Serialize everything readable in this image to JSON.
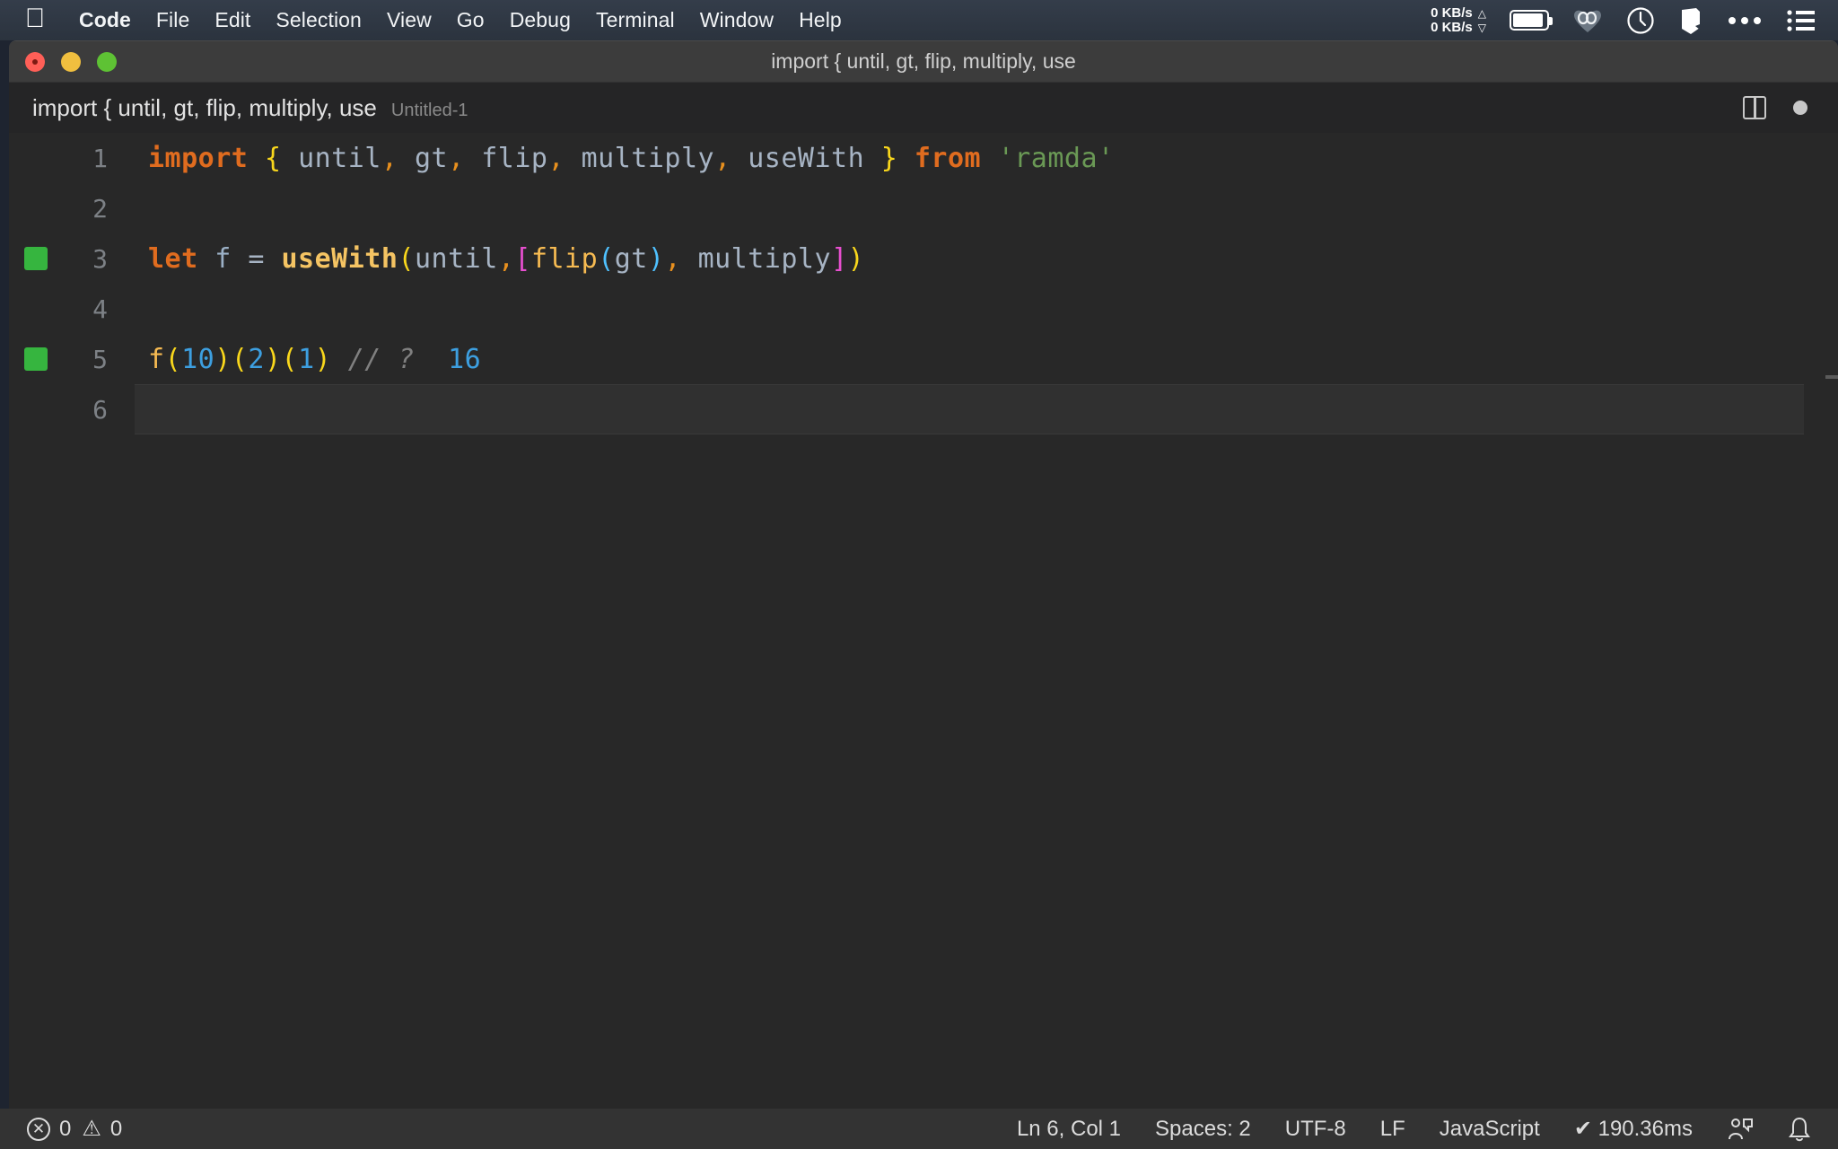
{
  "menubar": {
    "apple_icon": "apple-logo",
    "items": [
      "Code",
      "File",
      "Edit",
      "Selection",
      "View",
      "Go",
      "Debug",
      "Terminal",
      "Window",
      "Help"
    ],
    "status_icons": {
      "net_up": "0 KB/s",
      "net_down": "0 KB/s",
      "up_arrow": "△",
      "down_arrow": "▽",
      "battery": "battery-icon",
      "vpn": "vpn-icon",
      "clock": "clock-icon",
      "shield": "shield-icon",
      "more": "ellipsis-icon",
      "controlcenter": "list-icon"
    }
  },
  "window": {
    "title": "import { until, gt, flip, multiply, use",
    "traffic_lights": [
      "close",
      "minimize",
      "zoom"
    ]
  },
  "tab": {
    "label": "import { until, gt, flip, multiply, use",
    "sublabel": "Untitled-1",
    "split_editor_icon": "split-editor-icon",
    "dirty_indicator": "unsaved-dot-icon"
  },
  "editor": {
    "language": "JavaScript",
    "lines": [
      {
        "number": "1",
        "breakpoint": false,
        "active": false,
        "tokens": [
          {
            "t": "import",
            "c": "kw"
          },
          {
            "t": " ",
            "c": "ident"
          },
          {
            "t": "{",
            "c": "brace"
          },
          {
            "t": " ",
            "c": "ident"
          },
          {
            "t": "until",
            "c": "ident"
          },
          {
            "t": ",",
            "c": "comma"
          },
          {
            "t": " ",
            "c": "ident"
          },
          {
            "t": "gt",
            "c": "ident"
          },
          {
            "t": ",",
            "c": "comma"
          },
          {
            "t": " ",
            "c": "ident"
          },
          {
            "t": "flip",
            "c": "ident"
          },
          {
            "t": ",",
            "c": "comma"
          },
          {
            "t": " ",
            "c": "ident"
          },
          {
            "t": "multiply",
            "c": "ident"
          },
          {
            "t": ",",
            "c": "comma"
          },
          {
            "t": " ",
            "c": "ident"
          },
          {
            "t": "useWith",
            "c": "ident"
          },
          {
            "t": " ",
            "c": "ident"
          },
          {
            "t": "}",
            "c": "brace"
          },
          {
            "t": " ",
            "c": "ident"
          },
          {
            "t": "from",
            "c": "kw"
          },
          {
            "t": " ",
            "c": "ident"
          },
          {
            "t": "'ramda'",
            "c": "str"
          }
        ],
        "plain": "import { until, gt, flip, multiply, useWith } from 'ramda'"
      },
      {
        "number": "2",
        "breakpoint": false,
        "active": false,
        "tokens": [],
        "plain": ""
      },
      {
        "number": "3",
        "breakpoint": true,
        "active": false,
        "tokens": [
          {
            "t": "let",
            "c": "kw"
          },
          {
            "t": " ",
            "c": "ident"
          },
          {
            "t": "f",
            "c": "var"
          },
          {
            "t": " ",
            "c": "ident"
          },
          {
            "t": "=",
            "c": "op"
          },
          {
            "t": " ",
            "c": "ident"
          },
          {
            "t": "useWith",
            "c": "fn"
          },
          {
            "t": "(",
            "c": "brk1"
          },
          {
            "t": "until",
            "c": "ident"
          },
          {
            "t": ",",
            "c": "comma"
          },
          {
            "t": "[",
            "c": "brk2"
          },
          {
            "t": "flip",
            "c": "fn2"
          },
          {
            "t": "(",
            "c": "brk3"
          },
          {
            "t": "gt",
            "c": "ident"
          },
          {
            "t": ")",
            "c": "brk3"
          },
          {
            "t": ",",
            "c": "comma"
          },
          {
            "t": " ",
            "c": "ident"
          },
          {
            "t": "multiply",
            "c": "ident"
          },
          {
            "t": "]",
            "c": "brk2"
          },
          {
            "t": ")",
            "c": "brk1"
          }
        ],
        "plain": "let f = useWith(until,[flip(gt), multiply])"
      },
      {
        "number": "4",
        "breakpoint": false,
        "active": false,
        "tokens": [],
        "plain": ""
      },
      {
        "number": "5",
        "breakpoint": true,
        "active": false,
        "tokens": [
          {
            "t": "f",
            "c": "fn2"
          },
          {
            "t": "(",
            "c": "brk1"
          },
          {
            "t": "10",
            "c": "num"
          },
          {
            "t": ")",
            "c": "brk1"
          },
          {
            "t": "(",
            "c": "brk1"
          },
          {
            "t": "2",
            "c": "num"
          },
          {
            "t": ")",
            "c": "brk1"
          },
          {
            "t": "(",
            "c": "brk1"
          },
          {
            "t": "1",
            "c": "num"
          },
          {
            "t": ")",
            "c": "brk1"
          },
          {
            "t": " ",
            "c": "ident"
          },
          {
            "t": "// ?",
            "c": "comment"
          },
          {
            "t": "  ",
            "c": "ident"
          },
          {
            "t": "16",
            "c": "num"
          }
        ],
        "plain": "f(10)(2)(1) // ?  16"
      },
      {
        "number": "6",
        "breakpoint": false,
        "active": true,
        "tokens": [],
        "plain": ""
      }
    ]
  },
  "statusbar": {
    "errors": "0",
    "warnings": "0",
    "error_icon": "error-circle-icon",
    "warning_icon": "warning-triangle-icon",
    "cursor_position": "Ln 6, Col 1",
    "indentation": "Spaces: 2",
    "encoding": "UTF-8",
    "eol": "LF",
    "language": "JavaScript",
    "runtime": "✔ 190.36ms",
    "feedback_icon": "feedback-icon",
    "bell_icon": "bell-icon"
  },
  "colors": {
    "menubar_bg": "#2f3845",
    "window_bg": "#262626",
    "editor_bg": "#282828",
    "statusbar_bg": "#333333",
    "accent_keyword": "#e06c1f",
    "accent_string": "#6a9955",
    "accent_number": "#3d9fe0",
    "breakpoint_green": "#36b53f"
  }
}
